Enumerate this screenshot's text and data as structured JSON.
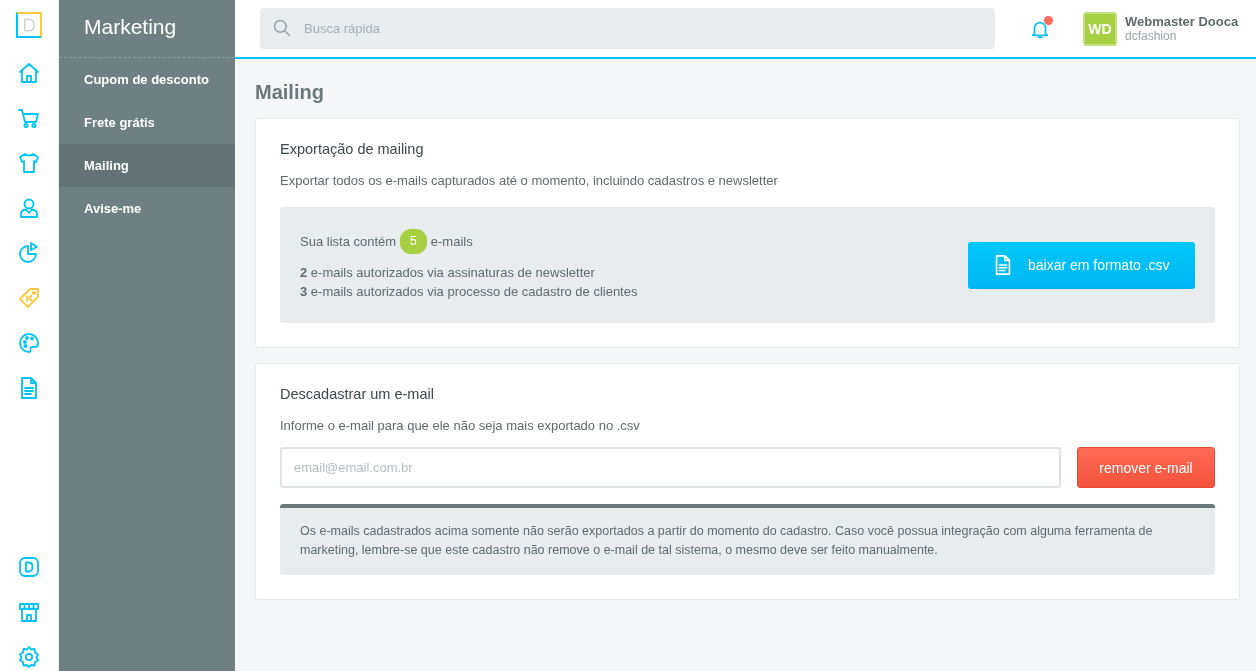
{
  "rail": {
    "items": [
      {
        "kind": "home",
        "selected": false
      },
      {
        "kind": "cart",
        "selected": false
      },
      {
        "kind": "shirt",
        "selected": false
      },
      {
        "kind": "user",
        "selected": false
      },
      {
        "kind": "chart",
        "selected": false
      },
      {
        "kind": "tag",
        "selected": true
      },
      {
        "kind": "palette",
        "selected": false
      },
      {
        "kind": "document",
        "selected": false
      }
    ],
    "bottom_items": [
      {
        "kind": "brand"
      },
      {
        "kind": "store"
      },
      {
        "kind": "settings"
      }
    ]
  },
  "sidebar": {
    "title": "Marketing",
    "items": [
      {
        "label": "Cupom de desconto",
        "selected": false
      },
      {
        "label": "Frete grátis",
        "selected": false
      },
      {
        "label": "Mailing",
        "selected": true
      },
      {
        "label": "Avise-me",
        "selected": false
      }
    ]
  },
  "topbar": {
    "search": {
      "placeholder": "Busca rápida"
    },
    "notifications": {
      "unread": true
    },
    "user": {
      "initials": "WD",
      "name": "Webmaster Dooca",
      "store": "dcfashion"
    }
  },
  "page": {
    "title": "Mailing"
  },
  "export_card": {
    "title": "Exportação de mailing",
    "description": "Exportar todos os e-mails capturados até o momento, incluindo cadastros e newsletter",
    "summary_prefix": "Sua lista contém",
    "count": "5",
    "summary_suffix": "e-mails",
    "lines": [
      "**2** e-mails autorizados via assinaturas de newsletter",
      "**3** e-mails autorizados via processo de cadastro de clientes"
    ],
    "button": "baixar em formato .csv"
  },
  "unsubscribe_card": {
    "title": "Descadastrar um e-mail",
    "description": "Informe o e-mail para que ele não seja mais exportado no .csv",
    "email": {
      "placeholder": "email@email.com.br"
    },
    "button": "remover e-mail",
    "notice": "Os e-mails cadastrados acima somente não serão exportados a partir do momento do cadastro. Caso você possua integração com alguma ferramenta de marketing, lembre-se que este cadastro não remove o e-mail de tal sistema, o mesmo deve ser feito manualmente."
  }
}
